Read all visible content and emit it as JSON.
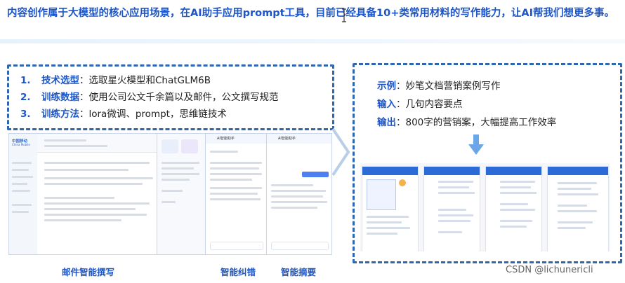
{
  "header": {
    "title": "内容创作属于大模型的核心应用场景，在AI助手应用prompt工具，目前已经具备10+类常用材料的写作能力，让AI帮我们想更多事。"
  },
  "left_panel": {
    "items": [
      {
        "num": "1.",
        "label": "技术选型",
        "text": "选取星火模型和ChatGLM6B"
      },
      {
        "num": "2.",
        "label": "训练数据",
        "text": "使用公司公文千余篇以及邮件，公文撰写规范"
      },
      {
        "num": "3.",
        "label": "训练方法",
        "text": "lora微调、prompt，思维链技术"
      }
    ]
  },
  "right_panel": {
    "items": [
      {
        "label": "示例",
        "text": "妙笔文档营销案例写作"
      },
      {
        "label": "输入",
        "text": "几句内容要点"
      },
      {
        "label": "输出",
        "text": "800字的营销案，大幅提高工作效率"
      }
    ]
  },
  "screenshots": {
    "mail": {
      "caption": "邮件智能撰写",
      "app_name": "中国移动",
      "app_sub": "China Mobile"
    },
    "assistant_a": {
      "caption": "智能纠错",
      "header": "AI智能助手"
    },
    "assistant_b": {
      "caption": "智能摘要",
      "header": "AI智能助手"
    }
  },
  "watermark": "CSDN @lichunericli",
  "colors": {
    "accent": "#1d56c9",
    "dashed_border": "#2f66b2",
    "app_blue": "#2c6bd6"
  },
  "icons": [
    "text-cursor-icon",
    "chevron-right-icon",
    "arrow-down-icon"
  ]
}
